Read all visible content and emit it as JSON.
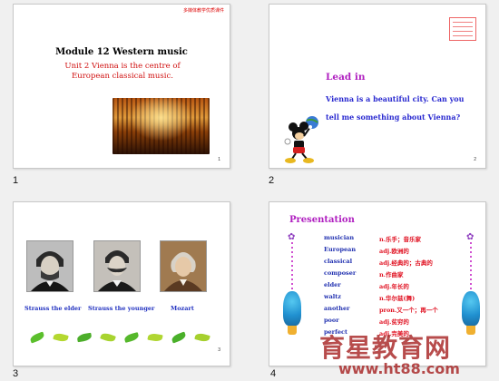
{
  "slides": [
    {
      "number": "1",
      "corner_text": "多媒体教学优质课件",
      "title": "Module 12 Western music",
      "subtitle": "Unit 2 Vienna is the centre of European classical music.",
      "page": "1"
    },
    {
      "number": "2",
      "heading": "Lead in",
      "question": "Vienna is a beautiful city. Can you tell me something about Vienna?",
      "page": "2"
    },
    {
      "number": "3",
      "captions": [
        "Strauss the elder",
        "Strauss the younger",
        "Mozart"
      ],
      "page": "3"
    },
    {
      "number": "4",
      "heading": "Presentation",
      "vocab": [
        {
          "word": "musician",
          "meaning": "n.乐手；音乐家"
        },
        {
          "word": "European",
          "meaning": "adj.欧洲的"
        },
        {
          "word": "classical",
          "meaning": "adj.经典的；古典的"
        },
        {
          "word": "composer",
          "meaning": "n.作曲家"
        },
        {
          "word": "elder",
          "meaning": "adj.年长的"
        },
        {
          "word": "waltz",
          "meaning": "n.华尔兹(舞)"
        },
        {
          "word": "another",
          "meaning": "pron.又一个；再一个"
        },
        {
          "word": "poor",
          "meaning": "adj.贫穷的"
        },
        {
          "word": "perfect",
          "meaning": "adj.完美的"
        }
      ]
    }
  ],
  "watermark": {
    "cn": "育星教育网",
    "url": "www.ht88.com"
  },
  "colors": {
    "heading": "#b020c0",
    "blue_text": "#2030c0",
    "red_text": "#e01020"
  }
}
